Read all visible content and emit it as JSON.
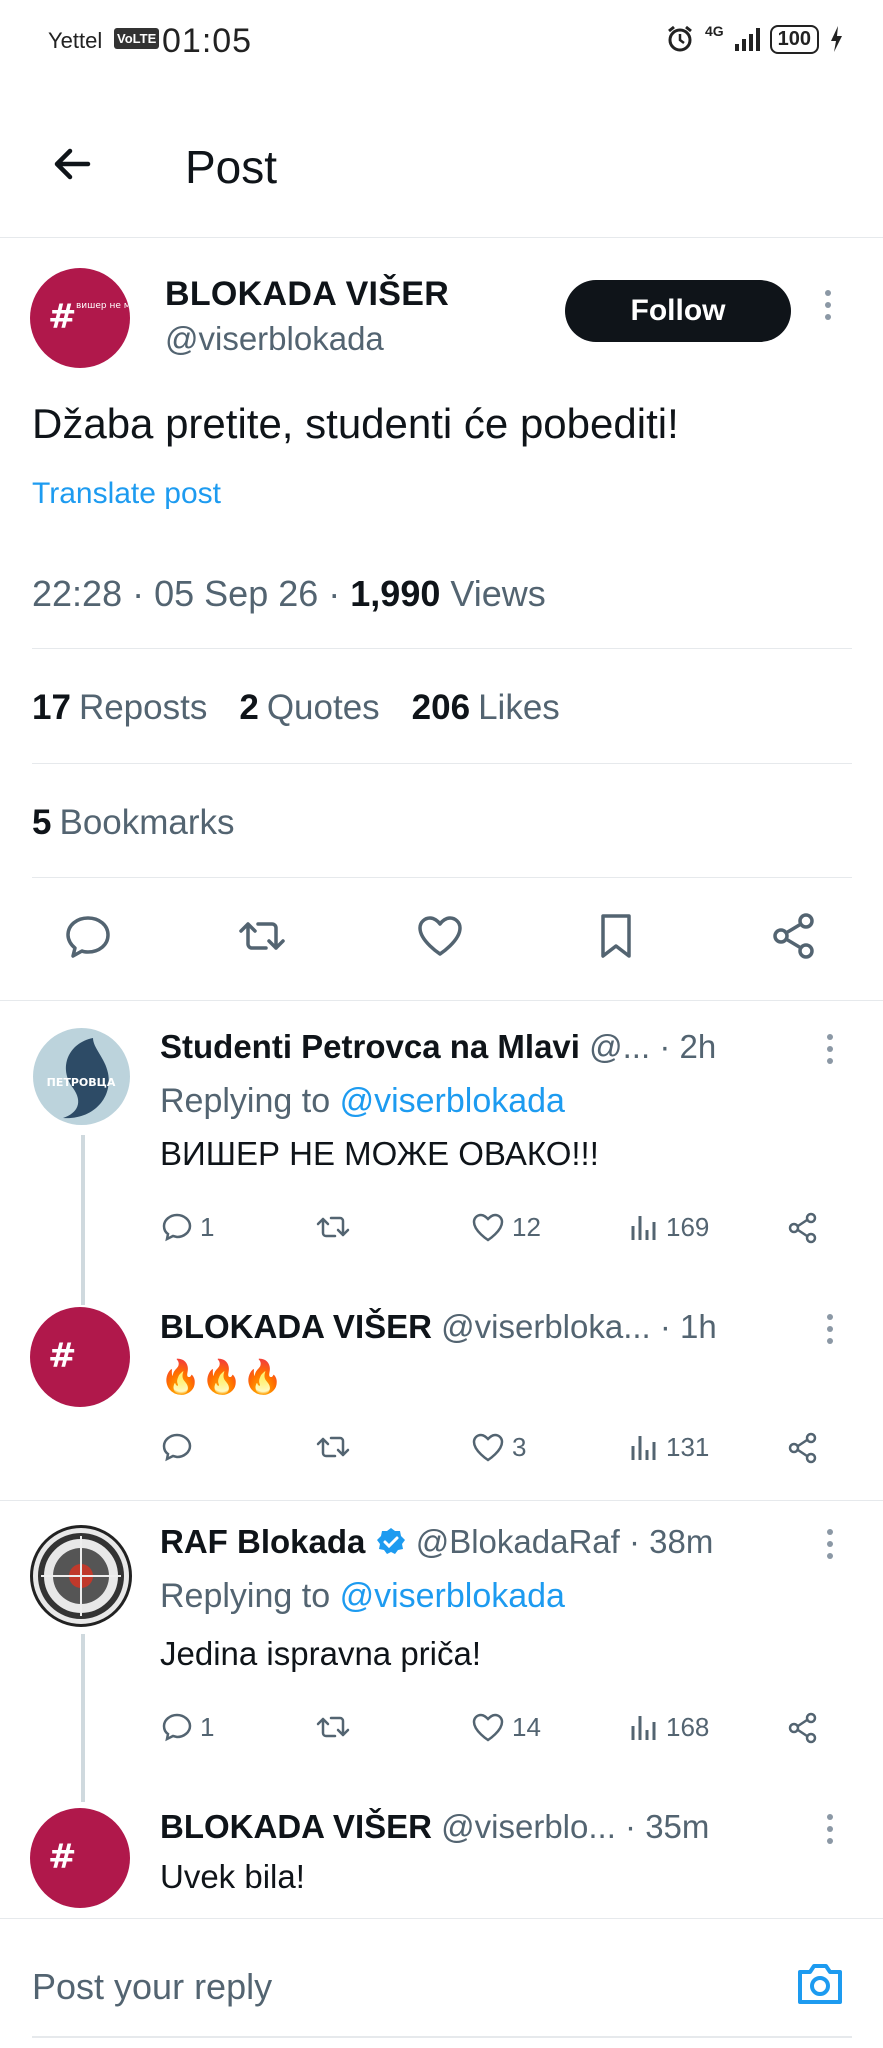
{
  "status_bar": {
    "carrier": "Yettel",
    "volte": "VoLTE",
    "time": "01:05",
    "network": "4G",
    "battery": "100"
  },
  "header": {
    "title": "Post"
  },
  "post": {
    "author_name": "BLOKADA VIŠER",
    "author_handle": "@viserblokada",
    "follow_label": "Follow",
    "text": "Džaba pretite, studenti će pobediti!",
    "translate_label": "Translate post",
    "time": "22:28",
    "date": "05 Sep 26",
    "views_count": "1,990",
    "views_label": "Views",
    "reposts_count": "17",
    "reposts_label": "Reposts",
    "quotes_count": "2",
    "quotes_label": "Quotes",
    "likes_count": "206",
    "likes_label": "Likes",
    "bookmarks_count": "5",
    "bookmarks_label": "Bookmarks",
    "avatar_text": "вишер не може овако"
  },
  "replies": [
    {
      "name": "Studenti Petrovca na Mlavi",
      "handle": "@...",
      "time": "· 2h",
      "replying_prefix": "Replying to",
      "replying_to": "@viserblokada",
      "text": "ВИШЕР НЕ МОЖЕ ОВАКО!!!",
      "replies": "1",
      "reposts": "",
      "likes": "12",
      "views": "169",
      "avatar_text": "ПЕТРОВЦА"
    },
    {
      "name": "BLOKADA VIŠER",
      "handle": "@viserbloka...",
      "time": "· 1h",
      "text": "🔥🔥🔥",
      "replies": "",
      "reposts": "",
      "likes": "3",
      "views": "131"
    },
    {
      "name": "RAF Blokada",
      "handle": "@BlokadaRaf",
      "time": "· 38m",
      "replying_prefix": "Replying to",
      "replying_to": "@viserblokada",
      "text": "Jedina ispravna priča!",
      "replies": "1",
      "reposts": "",
      "likes": "14",
      "views": "168"
    },
    {
      "name": "BLOKADA VIŠER",
      "handle": "@viserblo...",
      "time": "· 35m",
      "text": "Uvek bila!"
    }
  ],
  "composer": {
    "placeholder": "Post your reply"
  },
  "colors": {
    "accent": "#1d9bf0",
    "brand_avatar": "#b0184b",
    "verified": "#1d9bf0"
  }
}
